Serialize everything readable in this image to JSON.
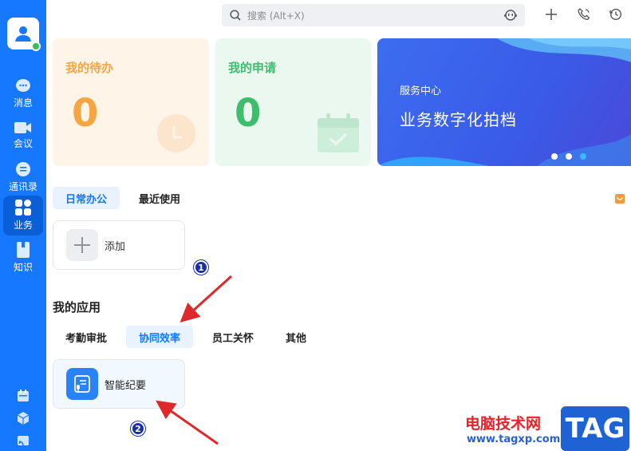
{
  "sidebar": {
    "nav": [
      {
        "label": "消息",
        "icon": "chat-icon"
      },
      {
        "label": "会议",
        "icon": "video-icon"
      },
      {
        "label": "通讯录",
        "icon": "contacts-icon"
      },
      {
        "label": "业务",
        "icon": "apps-grid-icon",
        "active": true
      },
      {
        "label": "知识",
        "icon": "book-icon"
      }
    ],
    "bottom_icons": [
      "calendar-icon",
      "cube-icon",
      "cast-icon"
    ]
  },
  "search": {
    "placeholder": "搜索 (Alt+X)"
  },
  "top_icons": [
    "plus-icon",
    "phone-icon",
    "history-icon"
  ],
  "cards": {
    "todo": {
      "title": "我的待办",
      "count": "0",
      "color": "#f5a643",
      "bg": "#fff4e8"
    },
    "request": {
      "title": "我的申请",
      "count": "0",
      "color": "#3ebd6d",
      "bg": "#eaf8ef"
    }
  },
  "banner": {
    "subtitle": "服务中心",
    "title": "业务数字化拍档",
    "slides": 3,
    "active_slide": 3
  },
  "tabs": {
    "items": [
      "日常办公",
      "最近使用"
    ],
    "active": "日常办公"
  },
  "add_card": {
    "label": "添加"
  },
  "my_apps": {
    "title": "我的应用",
    "tabs": [
      "考勤审批",
      "协同效率",
      "员工关怀",
      "其他"
    ],
    "active_tab": "协同效率",
    "apps": [
      {
        "label": "智能纪要",
        "icon": "smart-minutes-icon"
      }
    ]
  },
  "markers": [
    "1",
    "2"
  ],
  "watermark": {
    "text": "电脑技术网",
    "url": "www.tagxp.com",
    "tag": "TAG"
  },
  "colors": {
    "sidebar": "#1677ff",
    "accent": "#1677ff",
    "annotation_arrow": "#e0282a"
  }
}
